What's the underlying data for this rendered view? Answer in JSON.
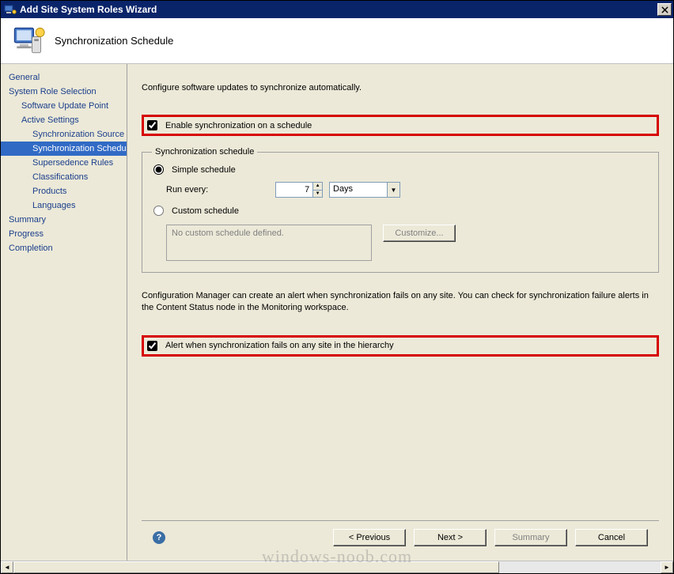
{
  "window": {
    "title": "Add Site System Roles Wizard"
  },
  "header": {
    "title": "Synchronization Schedule"
  },
  "nav": {
    "items": [
      {
        "label": "General",
        "level": 1
      },
      {
        "label": "System Role Selection",
        "level": 1
      },
      {
        "label": "Software Update Point",
        "level": 2
      },
      {
        "label": "Active Settings",
        "level": 2
      },
      {
        "label": "Synchronization Source",
        "level": 3
      },
      {
        "label": "Synchronization Schedule",
        "level": 3,
        "selected": true
      },
      {
        "label": "Supersedence Rules",
        "level": 3
      },
      {
        "label": "Classifications",
        "level": 3
      },
      {
        "label": "Products",
        "level": 3
      },
      {
        "label": "Languages",
        "level": 3
      },
      {
        "label": "Summary",
        "level": 1
      },
      {
        "label": "Progress",
        "level": 1
      },
      {
        "label": "Completion",
        "level": 1
      }
    ]
  },
  "content": {
    "desc": "Configure software updates to synchronize automatically.",
    "enable_label": "Enable synchronization on a schedule",
    "fieldset_legend": "Synchronization schedule",
    "simple_label": "Simple schedule",
    "run_every_label": "Run every:",
    "interval_value": "7",
    "interval_unit": "Days",
    "custom_label": "Custom schedule",
    "custom_text": "No custom schedule defined.",
    "customize_btn": "Customize...",
    "info_para": "Configuration Manager can create an alert when synchronization fails on any site. You can check for synchronization failure alerts in the Content Status node in the Monitoring workspace.",
    "alert_label": "Alert when synchronization fails on any site in the hierarchy"
  },
  "buttons": {
    "previous": "< Previous",
    "next": "Next >",
    "summary": "Summary",
    "cancel": "Cancel"
  },
  "watermark": "windows-noob.com"
}
